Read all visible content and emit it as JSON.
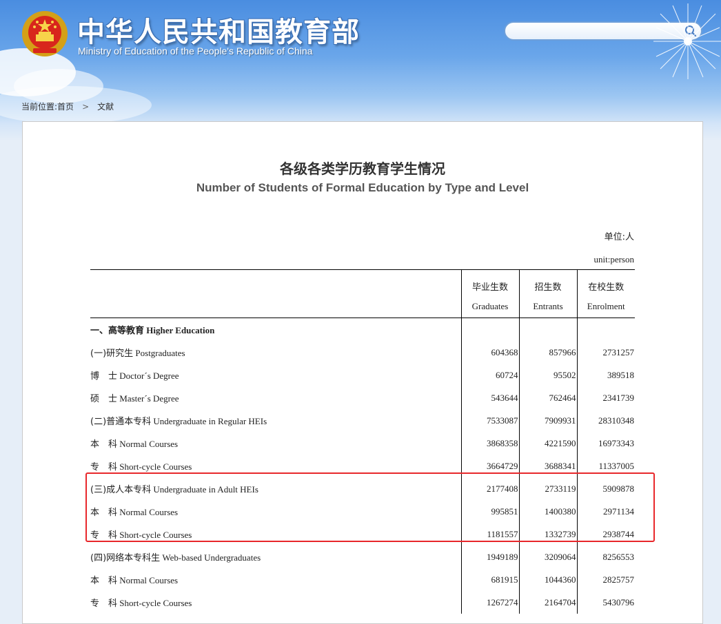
{
  "header": {
    "title_cn": "中华人民共和国教育部",
    "title_en": "Ministry of Education of the People's Republic of China",
    "search": {
      "value": "",
      "placeholder": ""
    }
  },
  "breadcrumb": {
    "prefix": "当前位置:",
    "items": [
      "首页",
      "文献"
    ],
    "separator": ">"
  },
  "document": {
    "title_cn": "各级各类学历教育学生情况",
    "title_en": "Number of Students of Formal Education by Type and Level",
    "unit_cn": "单位:人",
    "unit_en": "unit:person",
    "columns": [
      {
        "cn": "毕业生数",
        "en": "Graduates"
      },
      {
        "cn": "招生数",
        "en": "Entrants"
      },
      {
        "cn": "在校生数",
        "en": "Enrolment"
      }
    ],
    "rows": [
      {
        "cn": "一、高等教育",
        "en": "Higher Education",
        "graduates": "",
        "entrants": "",
        "enrolment": ""
      },
      {
        "cn": "(一)研究生",
        "en": "Postgraduates",
        "graduates": "604368",
        "entrants": "857966",
        "enrolment": "2731257"
      },
      {
        "cn": "博　士",
        "en": "Doctor´s Degree",
        "graduates": "60724",
        "entrants": "95502",
        "enrolment": "389518"
      },
      {
        "cn": "硕　士",
        "en": "Master´s Degree",
        "graduates": "543644",
        "entrants": "762464",
        "enrolment": "2341739"
      },
      {
        "cn": "(二)普通本专科",
        "en": "Undergraduate in Regular HEIs",
        "graduates": "7533087",
        "entrants": "7909931",
        "enrolment": "28310348"
      },
      {
        "cn": "本　科",
        "en": "Normal Courses",
        "graduates": "3868358",
        "entrants": "4221590",
        "enrolment": "16973343"
      },
      {
        "cn": "专　科",
        "en": "Short-cycle Courses",
        "graduates": "3664729",
        "entrants": "3688341",
        "enrolment": "11337005"
      },
      {
        "cn": "(三)成人本专科",
        "en": "Undergraduate in Adult HEIs",
        "graduates": "2177408",
        "entrants": "2733119",
        "enrolment": "5909878"
      },
      {
        "cn": "本　科",
        "en": "Normal Courses",
        "graduates": "995851",
        "entrants": "1400380",
        "enrolment": "2971134"
      },
      {
        "cn": "专　科",
        "en": "Short-cycle Courses",
        "graduates": "1181557",
        "entrants": "1332739",
        "enrolment": "2938744"
      },
      {
        "cn": "(四)网络本专科生",
        "en": "Web-based Undergraduates",
        "graduates": "1949189",
        "entrants": "3209064",
        "enrolment": "8256553"
      },
      {
        "cn": "本　科",
        "en": "Normal Courses",
        "graduates": "681915",
        "entrants": "1044360",
        "enrolment": "2825757"
      },
      {
        "cn": "专　科",
        "en": "Short-cycle Courses",
        "graduates": "1267274",
        "entrants": "2164704",
        "enrolment": "5430796"
      }
    ]
  },
  "colors": {
    "header_blue": "#4a8de0",
    "highlight_red": "#e8262a",
    "text": "#333333"
  }
}
